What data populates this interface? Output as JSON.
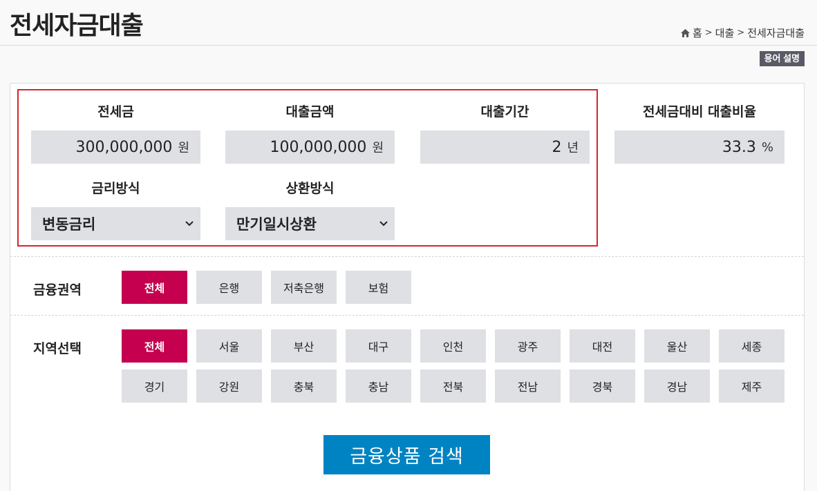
{
  "page_title": "전세자금대출",
  "breadcrumb": {
    "home": "홈",
    "level1": "대출",
    "level2": "전세자금대출",
    "separator": ">"
  },
  "glossary_button": "용어 설명",
  "fields": {
    "deposit": {
      "label": "전세금",
      "value": "300,000,000",
      "unit": "원"
    },
    "loan_amount": {
      "label": "대출금액",
      "value": "100,000,000",
      "unit": "원"
    },
    "loan_period": {
      "label": "대출기간",
      "value": "2",
      "unit": "년"
    },
    "loan_ratio": {
      "label": "전세금대비 대출비율",
      "value": "33.3",
      "unit": "%"
    },
    "rate_type": {
      "label": "금리방식",
      "selected": "변동금리"
    },
    "repayment": {
      "label": "상환방식",
      "selected": "만기일시상환"
    }
  },
  "sector": {
    "label": "금융권역",
    "options": [
      "전체",
      "은행",
      "저축은행",
      "보험"
    ],
    "active_index": 0
  },
  "region": {
    "label": "지역선택",
    "options": [
      "전체",
      "서울",
      "부산",
      "대구",
      "인천",
      "광주",
      "대전",
      "울산",
      "세종",
      "경기",
      "강원",
      "충북",
      "충남",
      "전북",
      "전남",
      "경북",
      "경남",
      "제주"
    ],
    "active_index": 0
  },
  "search_button": "금융상품 검색",
  "colors": {
    "accent": "#c5004f",
    "search": "#0083c3",
    "highlight": "#d9232e",
    "field_bg": "#dfe0e4"
  }
}
